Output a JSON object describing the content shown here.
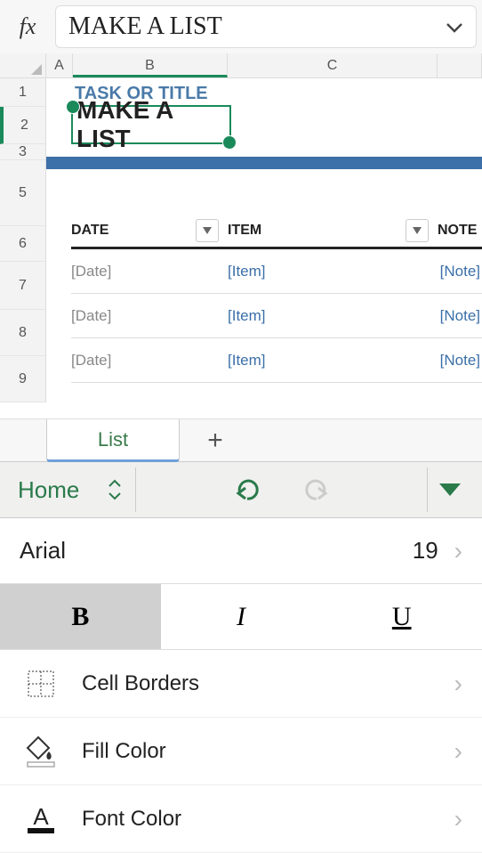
{
  "formula": {
    "fx": "fx",
    "value": "MAKE A LIST"
  },
  "columns": {
    "a": "A",
    "b": "B",
    "c": "C"
  },
  "rows": {
    "r1": "1",
    "r2": "2",
    "r3": "3",
    "r5": "5",
    "r6": "6",
    "r7": "7",
    "r8": "8",
    "r9": "9"
  },
  "cell": {
    "taskTitle": "TASK OR TITLE",
    "selected": "MAKE A LIST"
  },
  "table": {
    "head": {
      "date": "DATE",
      "item": "ITEM",
      "note": "NOTE"
    },
    "rows": [
      {
        "date": "[Date]",
        "item": "[Item]",
        "note": "[Note]"
      },
      {
        "date": "[Date]",
        "item": "[Item]",
        "note": "[Note]"
      },
      {
        "date": "[Date]",
        "item": "[Item]",
        "note": "[Note]"
      }
    ]
  },
  "tabs": {
    "active": "List",
    "add": "+"
  },
  "ribbon": {
    "name": "Home"
  },
  "font": {
    "name": "Arial",
    "size": "19"
  },
  "format": {
    "bold": "B",
    "italic": "I",
    "underline": "U"
  },
  "menu": {
    "borders": "Cell Borders",
    "fill": "Fill Color",
    "fontcolor": "Font Color"
  }
}
